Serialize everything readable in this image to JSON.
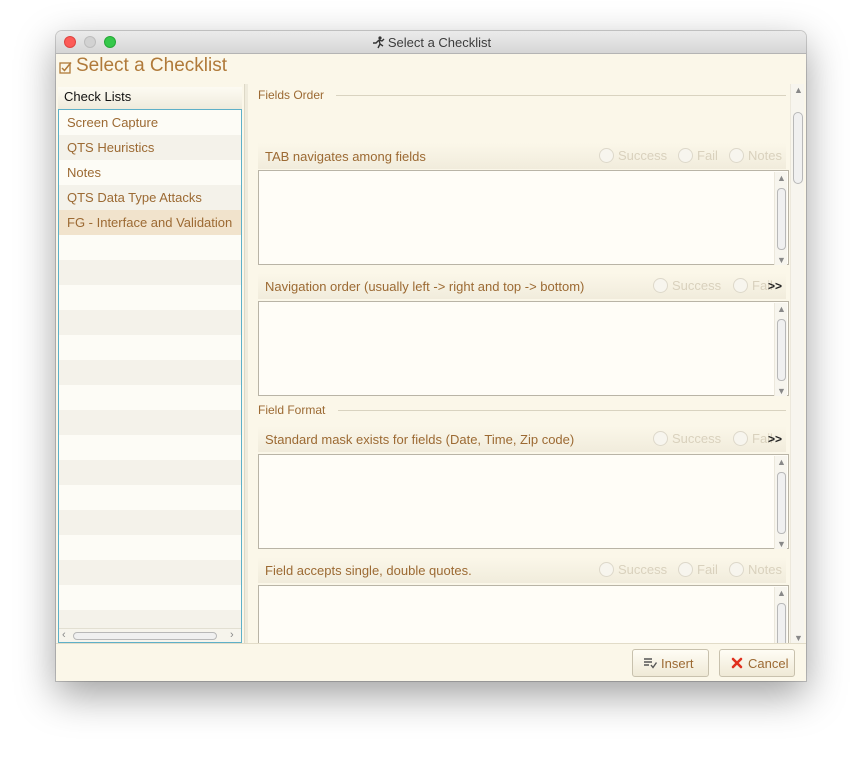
{
  "window": {
    "title": "Select a Checklist",
    "header_title": "Select a Checklist"
  },
  "checklists": {
    "header": "Check Lists",
    "items": [
      {
        "label": "Screen Capture"
      },
      {
        "label": "QTS Heuristics"
      },
      {
        "label": "Notes"
      },
      {
        "label": "QTS Data Type Attacks"
      },
      {
        "label": "FG - Interface and Validation"
      }
    ],
    "selected_index": 4
  },
  "sections": [
    {
      "title": "Fields Order"
    },
    {
      "title": "Field Format"
    }
  ],
  "fields": [
    {
      "label": "TAB navigates among fields",
      "options": [
        "Success",
        "Fail",
        "Notes"
      ]
    },
    {
      "label": "Navigation order (usually left -> right and top -> bottom)",
      "options": [
        "Success",
        "Fail"
      ],
      "more": ">>"
    },
    {
      "label": "Standard mask exists for fields (Date, Time, Zip code)",
      "options": [
        "Success",
        "Fail"
      ],
      "more": ">>"
    },
    {
      "label": "Field accepts single, double quotes.",
      "options": [
        "Success",
        "Fail",
        "Notes"
      ]
    }
  ],
  "buttons": {
    "insert": "Insert",
    "cancel": "Cancel"
  },
  "colors": {
    "accent_text": "#9c6a33",
    "title_text": "#b07a3a",
    "background": "#fbf7e9",
    "list_border": "#5eb0c8",
    "selected_row": "#f1e3cc",
    "cancel_icon": "#e0301e"
  },
  "icons": {
    "title": "runner-icon",
    "header": "checkbox-icon",
    "insert": "insert-list-icon",
    "cancel": "close-x-icon"
  }
}
